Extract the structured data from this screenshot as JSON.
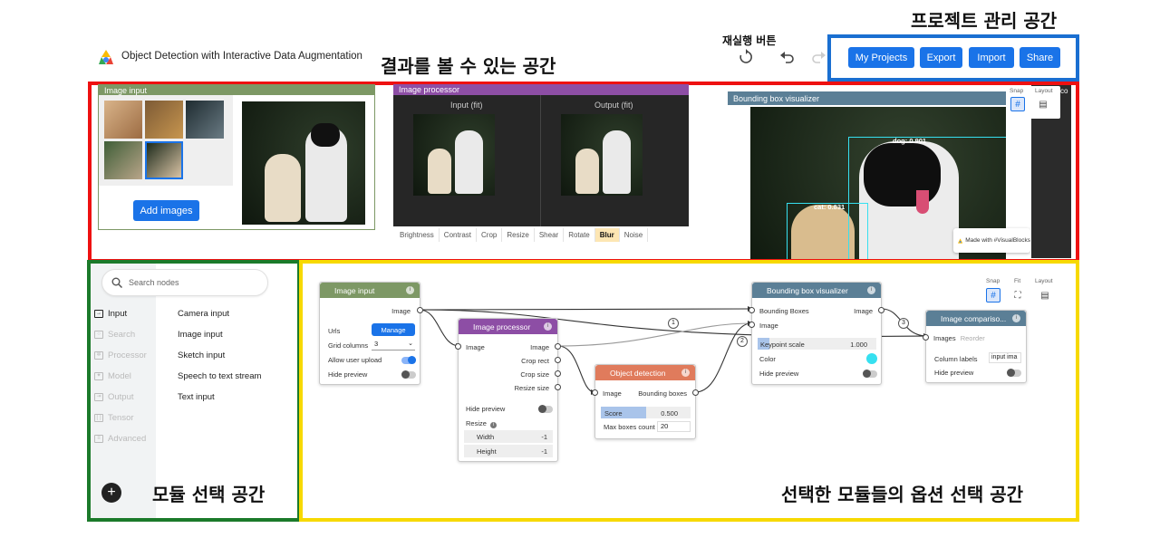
{
  "app": {
    "title": "Object Detection with Interactive Data Augmentation"
  },
  "annotations": {
    "project_area": "프로젝트 관리 공간",
    "rerun_button": "재실행 버튼",
    "result_area": "결과를 볼 수 있는 공간",
    "module_area": "모듈 선택 공간",
    "options_area": "선택한 모듈들의 옵션 선택 공간"
  },
  "project_buttons": [
    "My Projects",
    "Export",
    "Import",
    "Share"
  ],
  "image_input_panel": {
    "title": "Image input",
    "add_button": "Add images"
  },
  "image_processor_panel": {
    "title": "Image processor",
    "input_label": "Input (fit)",
    "output_label": "Output (fit)",
    "tabs": [
      "Brightness",
      "Contrast",
      "Crop",
      "Resize",
      "Shear",
      "Rotate",
      "Blur",
      "Noise"
    ],
    "active_tab": "Blur"
  },
  "bbox_panel": {
    "title": "Bounding box visualizer",
    "label_dog": "dog: 0.901",
    "label_cat": "cat: 0.831",
    "watermark": "Made with #VisualBlocks",
    "snap_label": "Snap",
    "layout_label": "Layout",
    "side_text": "co"
  },
  "sidebar": {
    "search_placeholder": "Search nodes",
    "categories": [
      "Input",
      "Search",
      "Processor",
      "Model",
      "Output",
      "Tensor",
      "Advanced"
    ],
    "active_category": "Input",
    "items": [
      "Camera input",
      "Image input",
      "Sketch input",
      "Speech to text stream",
      "Text input"
    ],
    "add_label": "+"
  },
  "canvas_tools": {
    "snap": "Snap",
    "fit": "Fit",
    "layout": "Layout"
  },
  "nodes": {
    "image_input": {
      "title": "Image input",
      "out_image": "Image",
      "urls_label": "Urls",
      "manage_label": "Manage",
      "grid_label": "Grid columns",
      "grid_value": "3",
      "upload_label": "Allow user upload",
      "upload_on": true,
      "hide_label": "Hide preview",
      "hide_on": false
    },
    "image_processor": {
      "title": "Image processor",
      "in_image": "Image",
      "out_image": "Image",
      "out_crop_rect": "Crop rect",
      "out_crop_size": "Crop size",
      "out_resize_size": "Resize size",
      "hide_label": "Hide preview",
      "resize_label": "Resize",
      "width_label": "Width",
      "width_value": "-1",
      "height_label": "Height",
      "height_value": "-1"
    },
    "object_detection": {
      "title": "Object detection",
      "in_image": "Image",
      "out_boxes": "Bounding boxes",
      "score_label": "Score",
      "score_value": "0.500",
      "score_fraction": 0.5,
      "maxboxes_label": "Max boxes count",
      "maxboxes_value": "20"
    },
    "bbox_visualizer": {
      "title": "Bounding box visualizer",
      "in_boxes": "Bounding Boxes",
      "in_image": "Image",
      "out_image": "Image",
      "keypoint_label": "Keypoint scale",
      "keypoint_value": "1.000",
      "keypoint_fraction": 0.1,
      "color_label": "Color",
      "color_value": "#36e0f0",
      "hide_label": "Hide preview"
    },
    "image_comparison": {
      "title": "Image compariso...",
      "in_images": "Images",
      "reorder_label": "Reorder",
      "col_labels_label": "Column labels",
      "col_labels_value": "input ima",
      "hide_label": "Hide preview"
    }
  },
  "edge_badges": [
    "1",
    "2",
    "3"
  ],
  "colors": {
    "red": "#ee1111",
    "green": "#1b7a2a",
    "yellow": "#f7d900",
    "blue": "#1a6fd1",
    "input_node": "#7d9865",
    "processor_node": "#8d4ea5",
    "detection_node": "#e07b5c",
    "visualizer_node": "#5b7f96",
    "comparison_node": "#5b7f96"
  }
}
